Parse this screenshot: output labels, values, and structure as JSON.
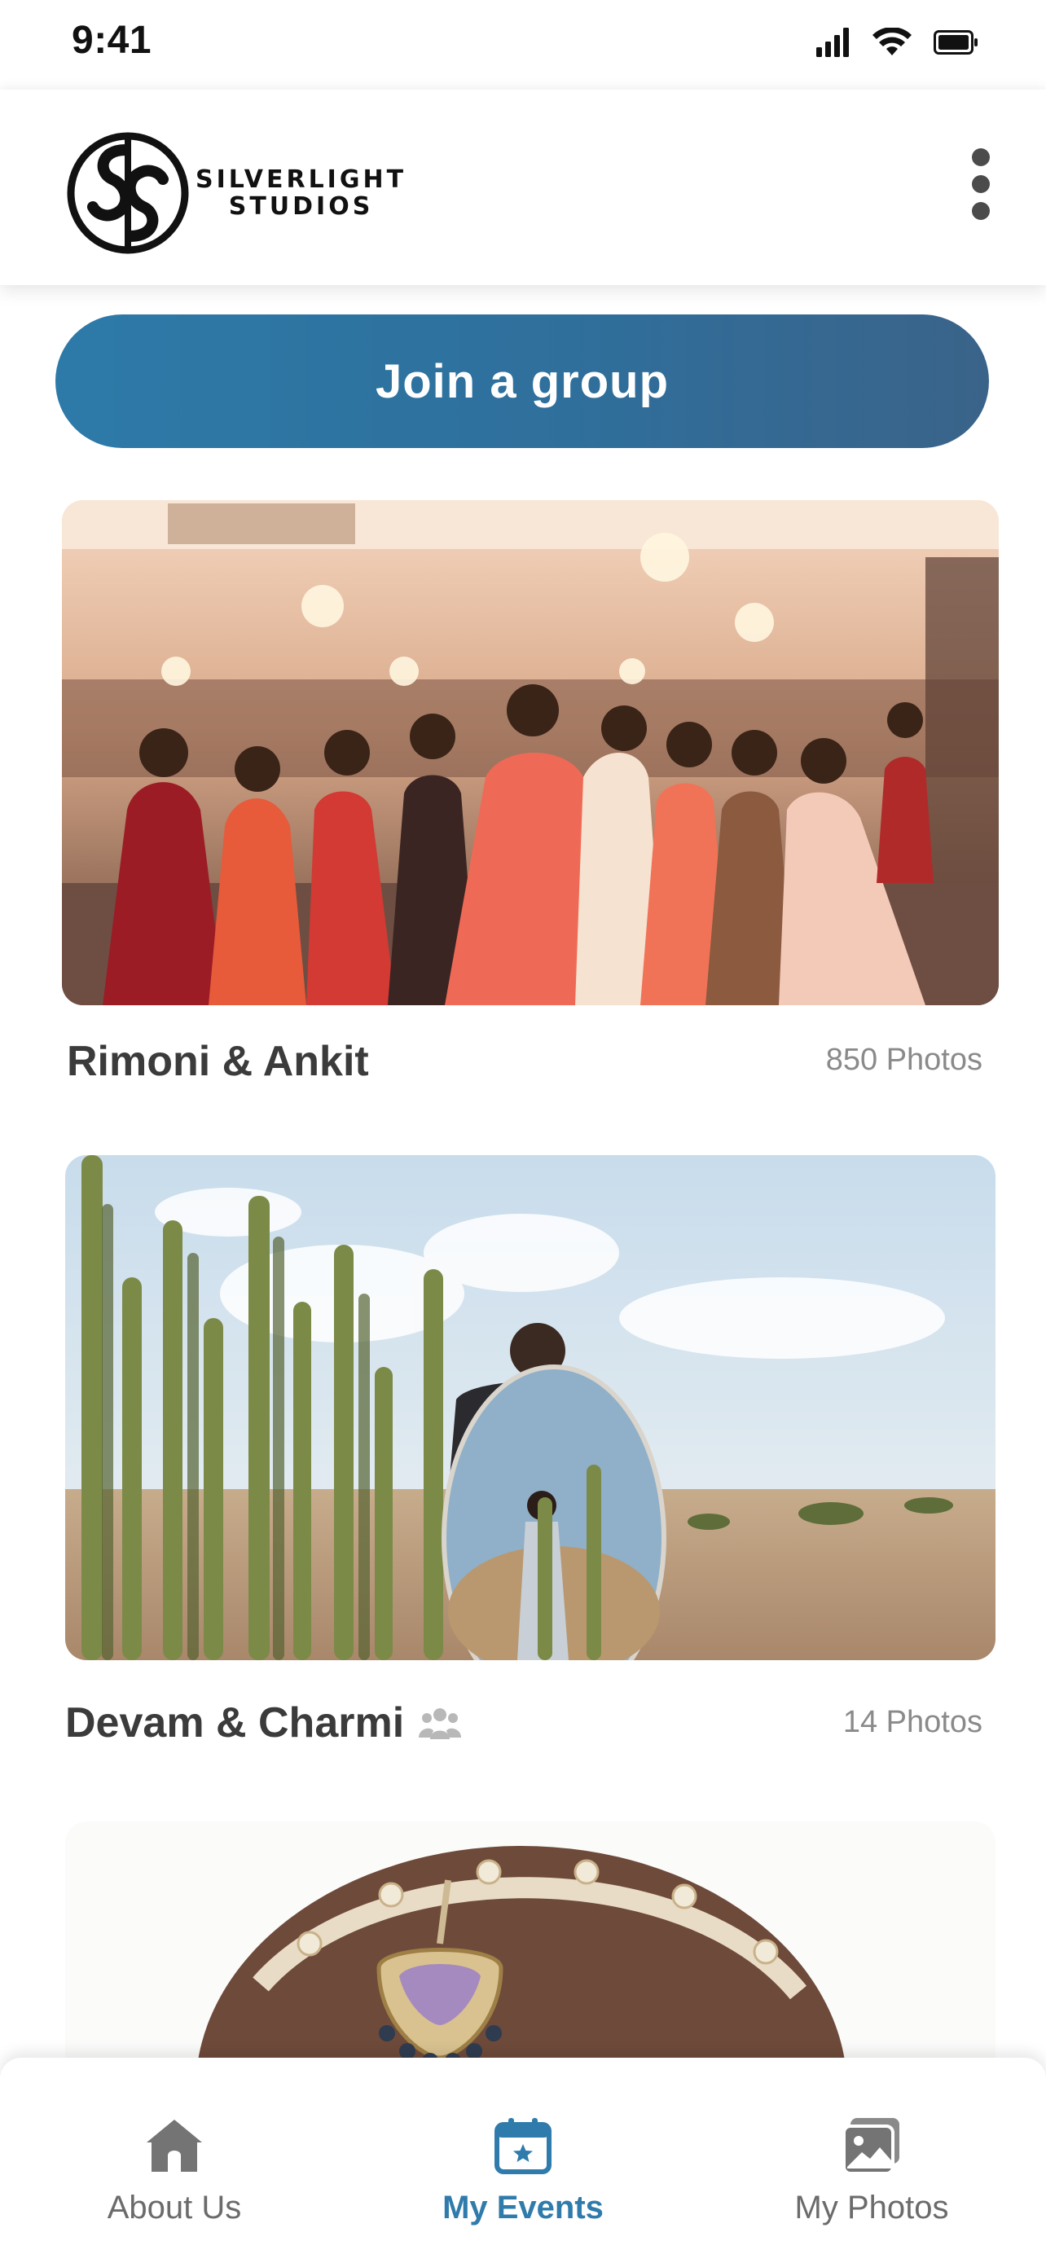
{
  "status_bar": {
    "time": "9:41"
  },
  "header": {
    "logo_line1": "SILVERLIGHT",
    "logo_line2": "STUDIOS"
  },
  "join_button_label": "Join a group",
  "events": [
    {
      "title": "Rimoni & Ankit",
      "photo_count": "850 Photos",
      "is_group": false
    },
    {
      "title": "Devam & Charmi",
      "photo_count": "14 Photos",
      "is_group": true
    },
    {
      "title": "",
      "photo_count": "",
      "is_group": false
    }
  ],
  "bottom_nav": {
    "items": [
      {
        "label": "About Us",
        "icon": "home-icon",
        "active": false
      },
      {
        "label": "My Events",
        "icon": "calendar-star-icon",
        "active": true
      },
      {
        "label": "My Photos",
        "icon": "photos-icon",
        "active": false
      }
    ]
  },
  "colors": {
    "accent": "#2f7bab",
    "join_button_start": "#2d7aa8",
    "join_button_end": "#3a6389",
    "inactive_nav": "#6b6b6b",
    "muted_text": "#8a8a8a"
  }
}
